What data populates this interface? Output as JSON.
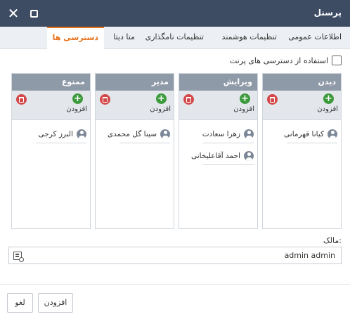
{
  "window": {
    "title": "پرسنل"
  },
  "tabs": [
    {
      "label": "اطلاعات عمومی"
    },
    {
      "label": "تنظیمات هوشمند"
    },
    {
      "label": "تنظیمات نامگذاری"
    },
    {
      "label": "متا دیتا"
    },
    {
      "label": "دسترسی ها"
    }
  ],
  "active_tab": "دسترسی ها",
  "parent_access": {
    "label": "استفاده از دسترسی های پرنت",
    "checked": false
  },
  "columns": [
    {
      "title": "دیدن",
      "add_label": "افزودن",
      "members": [
        "کیانا قهرمانی"
      ]
    },
    {
      "title": "ویرایش",
      "add_label": "افزودن",
      "members": [
        "زهرا سعادت",
        "احمد آقاعلیخانی"
      ]
    },
    {
      "title": "مدیر",
      "add_label": "افزودن",
      "members": [
        "سینا گل محمدی"
      ]
    },
    {
      "title": "ممنوع",
      "add_label": "افزودن",
      "members": [
        "البرز کرجی"
      ]
    }
  ],
  "owner": {
    "label": "مالک:",
    "value": "admin admin"
  },
  "footer": {
    "add_label": "افزودن",
    "cancel_label": "لغو"
  },
  "colors": {
    "titlebar": "#3d4b63",
    "accent": "#e8711a",
    "column_header": "#8f9aa8",
    "add_green": "#3c9a3c",
    "delete_red": "#d44a4a"
  },
  "icons": {
    "close": "close-icon",
    "maximize": "maximize-icon",
    "add": "plus-circle-icon",
    "delete": "trash-icon",
    "user": "user-avatar-icon",
    "picker": "select-user-icon"
  }
}
